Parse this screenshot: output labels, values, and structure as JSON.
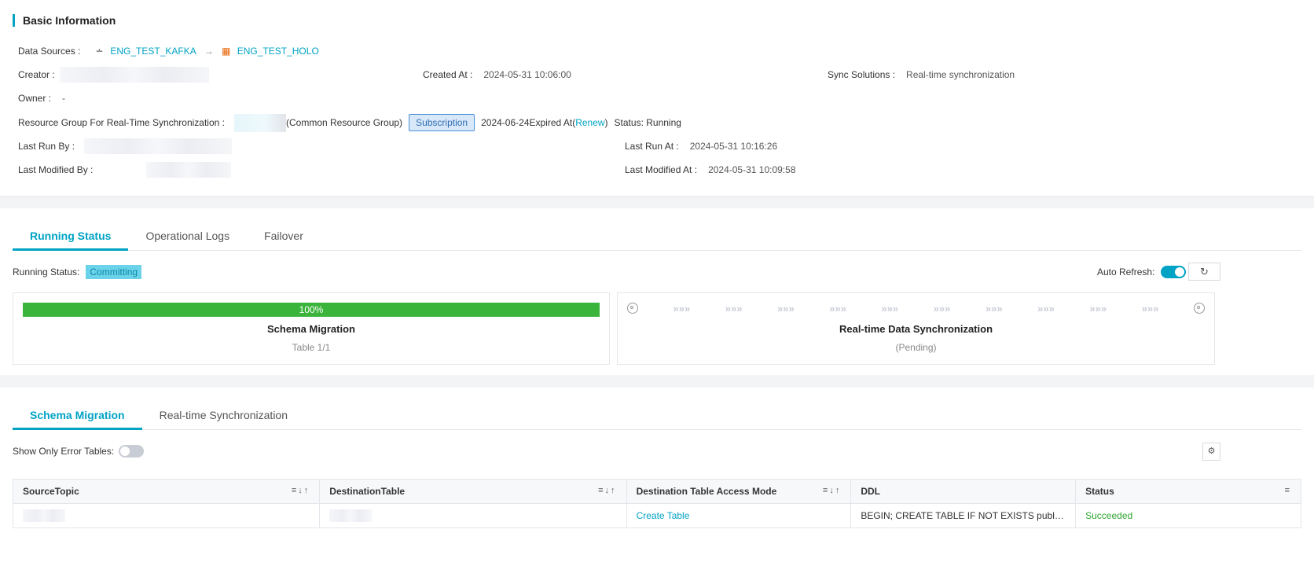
{
  "basic": {
    "title": "Basic Information",
    "data_sources_label": "Data Sources :",
    "source_name": "ENG_TEST_KAFKA",
    "arrow": "→",
    "dest_name": "ENG_TEST_HOLO",
    "creator_label": "Creator :",
    "created_at_label": "Created At :",
    "created_at": "2024-05-31 10:06:00",
    "sync_solutions_label": "Sync Solutions :",
    "sync_solutions": "Real-time synchronization",
    "owner_label": "Owner :",
    "owner": "-",
    "resource_group_label": "Resource Group For Real-Time Synchronization :",
    "resource_group_suffix": "(Common Resource Group)",
    "subscription_label": "Subscription",
    "expired_prefix": "2024-06-24Expired At(",
    "renew_label": "Renew",
    "expired_suffix": ")",
    "status_text": "Status: Running",
    "last_run_by_label": "Last Run By :",
    "last_run_at_label": "Last Run At :",
    "last_run_at": "2024-05-31 10:16:26",
    "last_modified_by_label": "Last Modified By :",
    "last_modified_at_label": "Last Modified At :",
    "last_modified_at": "2024-05-31 10:09:58"
  },
  "running": {
    "tabs": [
      "Running Status",
      "Operational Logs",
      "Failover"
    ],
    "status_label": "Running Status:",
    "status_badge": "Committing",
    "auto_refresh_label": "Auto Refresh:",
    "auto_refresh_on": true,
    "schema_panel": {
      "progress_percent": 100,
      "progress_text": "100%",
      "title": "Schema Migration",
      "subtitle": "Table 1/1"
    },
    "realtime_panel": {
      "title": "Real-time Data Synchronization",
      "subtitle": "(Pending)"
    }
  },
  "schema": {
    "tabs": [
      "Schema Migration",
      "Real-time Synchronization"
    ],
    "error_toggle_label": "Show Only Error Tables:",
    "error_toggle_on": false,
    "columns": [
      "SourceTopic",
      "DestinationTable",
      "Destination Table Access Mode",
      "DDL",
      "Status"
    ],
    "rows": [
      {
        "access_mode": "Create Table",
        "ddl": "BEGIN; CREATE TABLE IF NOT EXISTS public.t...",
        "status": "Succeeded"
      }
    ]
  },
  "colors": {
    "accent": "#00a3c4",
    "progress": "#3bb43b",
    "success": "#2fa52f",
    "holo": "#e8650a"
  },
  "icons": [
    "kafka-icon",
    "hologres-icon",
    "refresh-icon",
    "settings-icon",
    "filter-icon",
    "sort-icon",
    "pipeline-chevron-icon",
    "target-icon"
  ]
}
